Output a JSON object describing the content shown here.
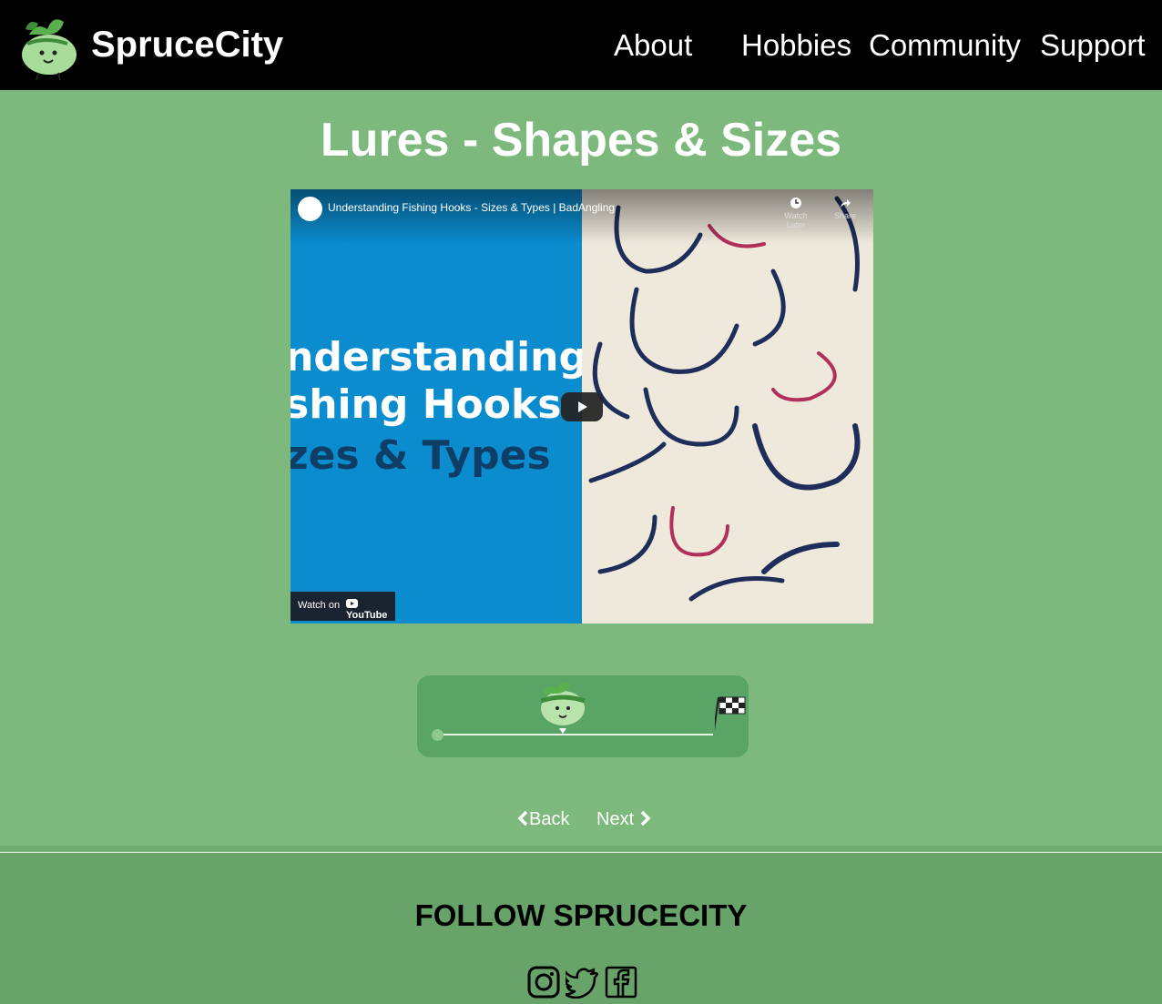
{
  "header": {
    "brand": "SpruceCity",
    "nav": [
      "About",
      "Hobbies",
      "Community",
      "Support"
    ]
  },
  "page": {
    "title": "Lures - Shapes & Sizes"
  },
  "video": {
    "title": "Understanding Fishing Hooks - Sizes & Types | BadAngling",
    "thumb_lines": [
      "nderstanding",
      "shing Hooks",
      "zes & Types"
    ],
    "watch_later": "Watch Later",
    "share": "Share",
    "watch_on": "Watch on",
    "youtube": "YouTube"
  },
  "progress": {
    "fraction": 0.45
  },
  "pager": {
    "back": "Back",
    "next": "Next"
  },
  "footer": {
    "follow": "FOLLOW SPRUCECITY",
    "social": [
      "instagram-icon",
      "twitter-icon",
      "facebook-icon"
    ]
  },
  "colors": {
    "background": "#7db97d",
    "header": "#000000",
    "progress_panel": "#5aa465",
    "footer": "#68a36a"
  }
}
